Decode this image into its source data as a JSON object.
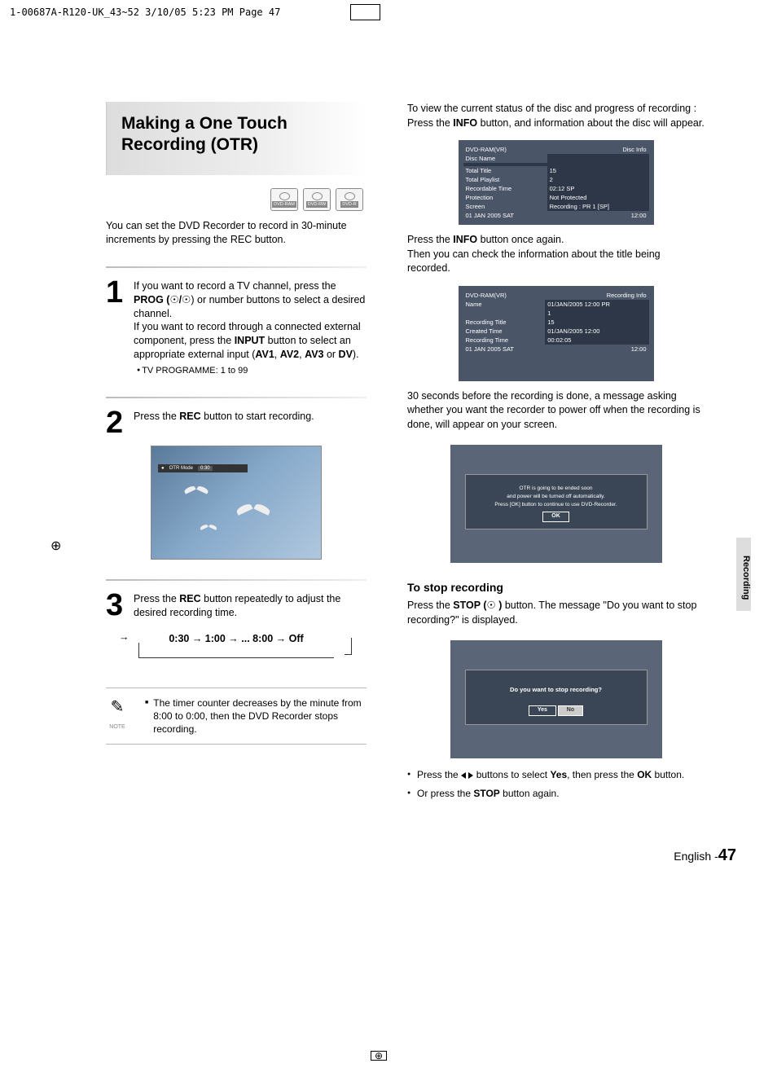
{
  "print_header": "1-00687A-R120-UK_43~52  3/10/05  5:23 PM  Page 47",
  "title": "Making a One Touch Recording (OTR)",
  "disc_types": [
    "DVD-RAM",
    "DVD-RW",
    "DVD-R"
  ],
  "intro": "You can set the DVD Recorder to record in 30-minute increments by pressing the REC button.",
  "step1": {
    "text_pre": "If you want to record a TV channel, press the ",
    "b1": "PROG (",
    "mid": ") or number buttons to select a desired channel.",
    "p2": "If you want to record through a connected external component, press the ",
    "b2": "INPUT",
    "p3": " button to select an appropriate external input (",
    "b3": "AV1",
    "b4": "AV2",
    "b5": "AV3",
    "b6": "DV",
    "p4": ").",
    "bullet": "TV PROGRAMME: 1 to 99"
  },
  "step2": {
    "pre": "Press the ",
    "b": "REC",
    "post": " button to start recording."
  },
  "tv_osd": {
    "label": "OTR Mode",
    "time": "0:30"
  },
  "step3": {
    "pre": "Press the ",
    "b": "REC",
    "post": " button repeatedly to adjust the desired recording time."
  },
  "cycle": "0:30 → 1:00 → ... 8:00 → Off",
  "note_label": "NOTE",
  "note": "The timer counter decreases by the minute from 8:00 to 0:00, then the DVD Recorder stops recording.",
  "rc1": {
    "pre": "To view the current status of the disc and progress of recording : Press the ",
    "b": "INFO",
    "post": " button, and information about the disc will appear."
  },
  "disc_info": {
    "hdr_l": "DVD-RAM(VR)",
    "hdr_r": "Disc Info",
    "rows": [
      [
        "Disc Name",
        ""
      ],
      [
        "Total Title",
        "15"
      ],
      [
        "Total Playlist",
        "2"
      ],
      [
        "Recordable Time",
        "02:12  SP"
      ],
      [
        "Protection",
        "Not Protected"
      ],
      [
        "Screen",
        "Recording :   PR 1 [SP]"
      ]
    ],
    "foot_l": "01 JAN 2005 SAT",
    "foot_r": "12:00"
  },
  "rc2": {
    "pre": "Press the ",
    "b": "INFO",
    "post1": " button once again.",
    "post2": "Then you can check the information about the title being recorded."
  },
  "rec_info": {
    "hdr_l": "DVD-RAM(VR)",
    "hdr_r": "Recording Info",
    "rows": [
      [
        "Name",
        "01/JAN/2005 12:00 PR"
      ],
      [
        "",
        "1"
      ],
      [
        "Recording Title",
        "15"
      ],
      [
        "Created Time",
        "01/JAN/2005 12:00"
      ],
      [
        "Recording Time",
        "00:02:05"
      ]
    ],
    "foot_l": "01 JAN 2005 SAT",
    "foot_r": "12:00"
  },
  "rc3": "30 seconds before the recording is done, a message asking whether you want the recorder to power off when the recording is done, will appear on your screen.",
  "osd1": {
    "l1": "OTR is going to be ended soon",
    "l2": "and power will be turned off automatically.",
    "l3": "Press [OK] button to continue to use DVD-Recorder.",
    "btn": "OK"
  },
  "stop_h": "To stop recording",
  "stop_p": {
    "pre": "Press the ",
    "b": "STOP (",
    "post": " )",
    "tail": " button. The message \"Do you want to stop recording?\" is displayed."
  },
  "osd2": {
    "msg": "Do you want to stop recording?",
    "yes": "Yes",
    "no": "No"
  },
  "bl1": {
    "pre": "Press the ",
    "mid": " buttons to select ",
    "b": "Yes",
    "post": ", then press the ",
    "b2": "OK",
    "tail": " button."
  },
  "bl2": {
    "pre": "Or press the ",
    "b": "STOP",
    "post": " button again."
  },
  "side_tab": "Recording",
  "page_pre": "English -",
  "page_num": "47"
}
